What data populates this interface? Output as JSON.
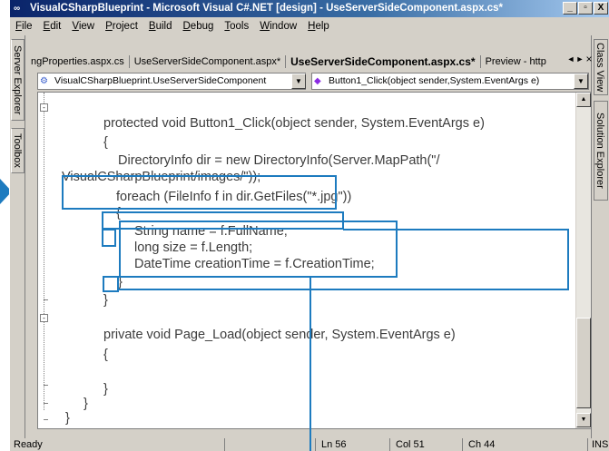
{
  "window": {
    "title": "VisualCSharpBlueprint - Microsoft Visual C#.NET [design] - UseServerSideComponent.aspx.cs*",
    "buttons": {
      "minimize": "_",
      "maximize": "&#x25A1;",
      "close": "X"
    }
  },
  "menu": [
    "File",
    "Edit",
    "View",
    "Project",
    "Build",
    "Debug",
    "Tools",
    "Window",
    "Help"
  ],
  "menu_underline": [
    "F",
    "E",
    "V",
    "P",
    "B",
    "D",
    "T",
    "W",
    "H"
  ],
  "left_panels": [
    "Server Explorer",
    "Toolbox"
  ],
  "right_panels": [
    "Class View",
    "Solution Explorer"
  ],
  "tabs": [
    {
      "label": "ngProperties.aspx.cs",
      "active": false
    },
    {
      "label": "UseServerSideComponent.aspx*",
      "active": false
    },
    {
      "label": "UseServerSideComponent.aspx.cs*",
      "active": true
    },
    {
      "label": "Preview - http",
      "active": false
    }
  ],
  "tab_nav": {
    "left": "◄",
    "right": "►",
    "close": "×"
  },
  "dropdowns": {
    "class": "VisualCSharpBlueprint.UseServerSideComponent",
    "member": "Button1_Click(object sender,System.EventArgs e)"
  },
  "code_lines": [
    "protected void Button1_Click(object sender, System.EventArgs e)",
    "{",
    "DirectoryInfo dir = new DirectoryInfo(Server.MapPath(\"/",
    "VisualCSharpBlueprint/images/\"));",
    "foreach (FileInfo f in dir.GetFiles(\"*.jpg\"))",
    "{",
    "String name = f.FullName;",
    "long size = f.Length;",
    "DateTime creationTime = f.CreationTime;",
    "}",
    "}",
    "private void Page_Load(object sender, System.EventArgs e)",
    "{",
    "}",
    "}",
    "}"
  ],
  "status": {
    "ready": "Ready",
    "line": "Ln 56",
    "col": "Col 51",
    "ch": "Ch 44",
    "mode": "INS"
  },
  "colors": {
    "callout": "#1d7bbf",
    "titlebar": "#0a246a"
  }
}
